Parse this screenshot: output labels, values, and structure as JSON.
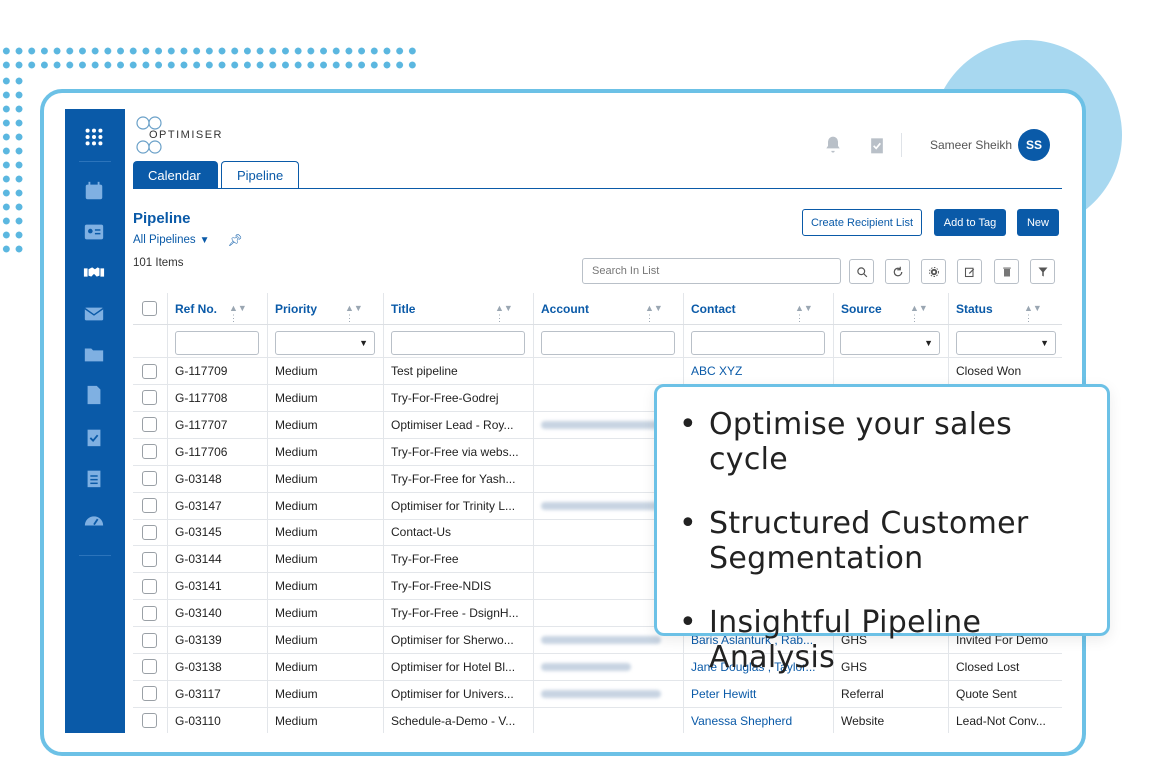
{
  "header": {
    "logo_text": "OPTIMISER",
    "user_name": "Sameer Sheikh",
    "avatar_initials": "SS"
  },
  "tabs": [
    "Calendar",
    "Pipeline"
  ],
  "page": {
    "title": "Pipeline",
    "view_selector": "All Pipelines",
    "item_count": "101 Items"
  },
  "actions": {
    "create_recipient_list": "Create Recipient List",
    "add_to_tag": "Add to Tag",
    "new": "New"
  },
  "search": {
    "placeholder": "Search In List"
  },
  "table": {
    "columns": [
      "Ref No.",
      "Priority",
      "Title",
      "Account",
      "Contact",
      "Source",
      "Status"
    ],
    "rows": [
      {
        "ref": "G-117709",
        "priority": "Medium",
        "title": "Test pipeline",
        "account": "",
        "contact": "ABC XYZ",
        "source": "",
        "status": "Closed Won"
      },
      {
        "ref": "G-117708",
        "priority": "Medium",
        "title": "Try-For-Free-Godrej",
        "account": "",
        "contact": "",
        "source": "",
        "status": ""
      },
      {
        "ref": "G-117707",
        "priority": "Medium",
        "title": "Optimiser Lead - Roy...",
        "account": "Royal Over Base Lo...",
        "contact": "",
        "source": "",
        "status": ""
      },
      {
        "ref": "G-117706",
        "priority": "Medium",
        "title": "Try-For-Free via webs...",
        "account": "",
        "contact": "",
        "source": "",
        "status": ""
      },
      {
        "ref": "G-03148",
        "priority": "Medium",
        "title": "Try-For-Free for Yash...",
        "account": "",
        "contact": "",
        "source": "",
        "status": ""
      },
      {
        "ref": "G-03147",
        "priority": "Medium",
        "title": "Optimiser for Trinity L...",
        "account": "Trinity Lutheran Col...",
        "contact": "",
        "source": "",
        "status": ""
      },
      {
        "ref": "G-03145",
        "priority": "Medium",
        "title": "Contact-Us",
        "account": "",
        "contact": "",
        "source": "",
        "status": ""
      },
      {
        "ref": "G-03144",
        "priority": "Medium",
        "title": "Try-For-Free",
        "account": "",
        "contact": "",
        "source": "",
        "status": ""
      },
      {
        "ref": "G-03141",
        "priority": "Medium",
        "title": "Try-For-Free-NDIS",
        "account": "",
        "contact": "",
        "source": "",
        "status": ""
      },
      {
        "ref": "G-03140",
        "priority": "Medium",
        "title": "Try-For-Free - DsignH...",
        "account": "",
        "contact": "",
        "source": "",
        "status": ""
      },
      {
        "ref": "G-03139",
        "priority": "Medium",
        "title": "Optimiser for Sherwo...",
        "account": "Sherwood Resorts an...",
        "contact": "Baris Aslanturk , Rab...",
        "source": "GHS",
        "status": "Invited For Demo"
      },
      {
        "ref": "G-03138",
        "priority": "Medium",
        "title": "Optimiser for Hotel Bl...",
        "account": "Hotel Blackfoot",
        "contact": "Jane Douglas , Taylor...",
        "source": "GHS",
        "status": "Closed Lost"
      },
      {
        "ref": "G-03117",
        "priority": "Medium",
        "title": "Optimiser for Univers...",
        "account": "Universal Defence an...",
        "contact": "Peter Hewitt",
        "source": "Referral",
        "status": "Quote Sent"
      },
      {
        "ref": "G-03110",
        "priority": "Medium",
        "title": "Schedule-a-Demo - V...",
        "account": "",
        "contact": "Vanessa Shepherd",
        "source": "Website",
        "status": "Lead-Not Conv..."
      }
    ]
  },
  "callout": {
    "items": [
      "Optimise your sales cycle",
      "Structured Customer Segmentation",
      "Insightful Pipeline Analysis"
    ]
  },
  "colors": {
    "brand": "#0a5aa8",
    "accent_frame": "#6cc1e6",
    "blob": "#a8d8f0"
  },
  "icons": {
    "rail": [
      "grid-apps-icon",
      "calendar-icon",
      "contact-card-icon",
      "handshake-icon",
      "mail-icon",
      "folder-icon",
      "document-icon",
      "checklist-icon",
      "clipboard-icon",
      "dashboard-gauge-icon"
    ]
  }
}
